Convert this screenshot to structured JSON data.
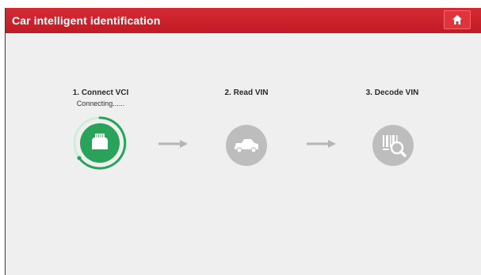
{
  "header": {
    "title": "Car intelligent identification",
    "home_icon": "home-icon"
  },
  "steps": [
    {
      "label": "1. Connect VCI",
      "status": "Connecting......",
      "icon": "vci-connector-icon",
      "state": "active"
    },
    {
      "label": "2. Read VIN",
      "icon": "car-icon",
      "state": "pending"
    },
    {
      "label": "3. Decode VIN",
      "icon": "barcode-search-icon",
      "state": "pending"
    }
  ],
  "colors": {
    "header": "#c8202a",
    "active": "#2aa35a",
    "pending": "#bdbdbd",
    "arrow": "#b5b5b5"
  }
}
